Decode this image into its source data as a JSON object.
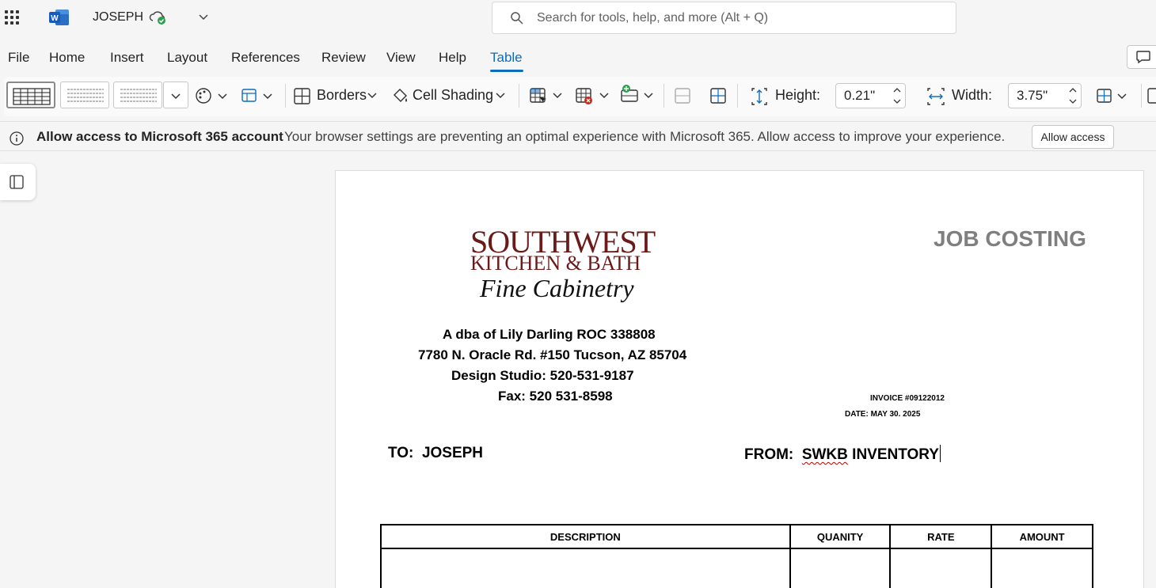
{
  "titlebar": {
    "doc_name": "JOSEPH",
    "search_placeholder": "Search for tools, help, and more (Alt + Q)"
  },
  "menu": {
    "items": [
      "File",
      "Home",
      "Insert",
      "Layout",
      "References",
      "Review",
      "View",
      "Help",
      "Table"
    ],
    "active": "Table"
  },
  "ribbon": {
    "borders_label": "Borders",
    "cell_shading_label": "Cell Shading",
    "height_label": "Height:",
    "height_value": "0.21\"",
    "width_label": "Width:",
    "width_value": "3.75\""
  },
  "infobar": {
    "title": "Allow access to Microsoft 365 account",
    "message": "Your browser settings are preventing an optimal experience with Microsoft 365. Allow access to improve your experience.",
    "button": "Allow access"
  },
  "document": {
    "logo": {
      "line1": "SOUTHWEST",
      "line2": "KITCHEN & BATH",
      "line3": "Fine Cabinetry"
    },
    "title": "JOB COSTING",
    "address": [
      "A dba of Lily Darling ROC 338808",
      "7780 N. Oracle Rd. #150 Tucson, AZ 85704",
      "Design Studio:  520-531-9187",
      "Fax: 520 531-8598"
    ],
    "invoice": "INVOICE #09122012",
    "date": "DATE: MAY 30. 2025",
    "to_label": "TO:",
    "to_value": "JOSEPH",
    "from_label": "FROM:",
    "from_value_misspelled": "SWKB",
    "from_value_rest": " INVENTORY",
    "table_headers": [
      "DESCRIPTION",
      "QUANITY",
      "RATE",
      "AMOUNT"
    ]
  },
  "colors": {
    "accent": "#0f6cbd",
    "logo_red": "#6b1a1a",
    "title_gray": "#7f7f7f"
  }
}
